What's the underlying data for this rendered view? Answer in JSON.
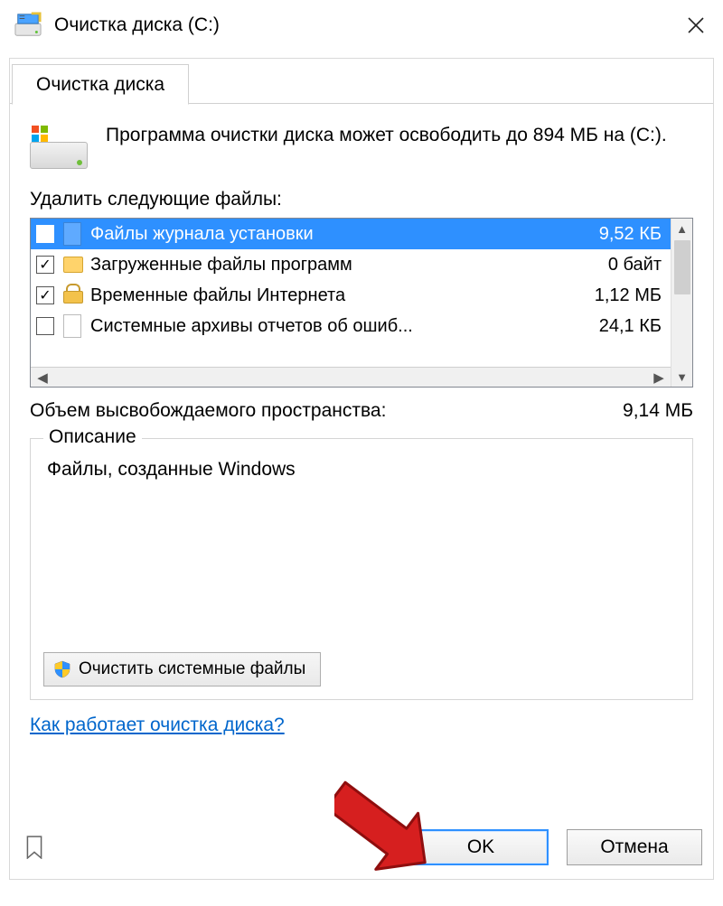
{
  "window": {
    "title": "Очистка диска  (C:)"
  },
  "tab": {
    "label": "Очистка диска"
  },
  "summary": {
    "text": "Программа очистки диска может освободить до 894 МБ на  (C:)."
  },
  "list": {
    "label": "Удалить следующие файлы:",
    "items": [
      {
        "checked": false,
        "selected": true,
        "icon": "page-blue",
        "name": "Файлы журнала установки",
        "size": "9,52 КБ"
      },
      {
        "checked": true,
        "selected": false,
        "icon": "folder",
        "name": "Загруженные файлы программ",
        "size": "0 байт"
      },
      {
        "checked": true,
        "selected": false,
        "icon": "lock",
        "name": "Временные файлы Интернета",
        "size": "1,12 МБ"
      },
      {
        "checked": false,
        "selected": false,
        "icon": "page",
        "name": "Системные архивы отчетов об ошиб...",
        "size": "24,1 КБ"
      }
    ]
  },
  "total": {
    "label": "Объем высвобождаемого пространства:",
    "value": "9,14 МБ"
  },
  "description": {
    "legend": "Описание",
    "text": "Файлы, созданные Windows"
  },
  "buttons": {
    "clean_system": "Очистить системные файлы",
    "ok": "OK",
    "cancel": "Отмена"
  },
  "help_link": "Как работает очистка диска?"
}
